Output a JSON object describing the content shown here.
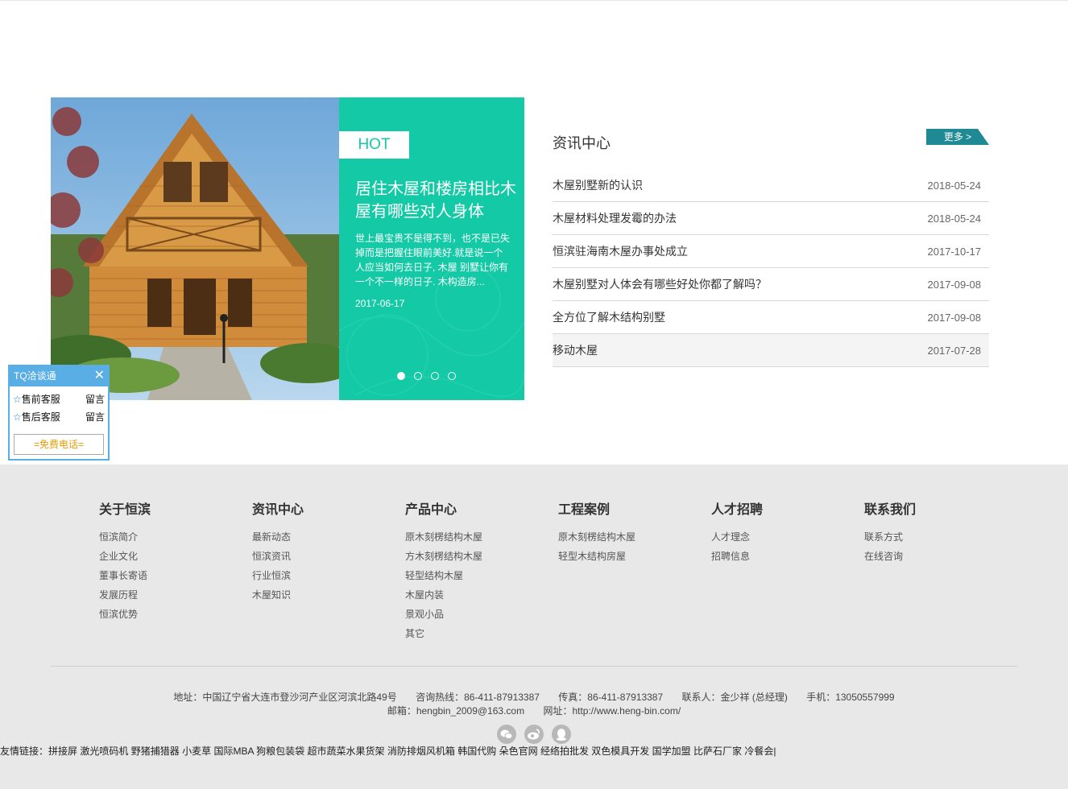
{
  "slider": {
    "tag": "HOT",
    "title": "居住木屋和楼房相比木屋有哪些对人身体",
    "summary": "世上最宝贵不是得不到，也不是已失掉而是把握住眼前美好.就是说一个人应当如何去日子, 木屋 别墅让你有一个不一样的日子. 木构造房...",
    "date": "2017-06-17",
    "dots": 4,
    "active_dot": 1,
    "accent_color": "#14c9a5"
  },
  "news": {
    "title": "资讯中心",
    "more_label": "更多 >",
    "items": [
      {
        "title": "木屋别墅新的认识",
        "date": "2018-05-24"
      },
      {
        "title": "木屋材料处理发霉的办法",
        "date": "2018-05-24"
      },
      {
        "title": "恒滨驻海南木屋办事处成立",
        "date": "2017-10-17"
      },
      {
        "title": "木屋别墅对人体会有哪些好处你都了解吗？",
        "date": "2017-09-08"
      },
      {
        "title": "全方位了解木结构别墅",
        "date": "2017-09-08"
      },
      {
        "title": "移动木屋",
        "date": "2017-07-28"
      }
    ]
  },
  "tq": {
    "title": "TQ洽谈通",
    "close": "✕",
    "rows": [
      {
        "label": "售前客服",
        "action": "留言"
      },
      {
        "label": "售后客服",
        "action": "留言"
      }
    ],
    "call": "=免费电话="
  },
  "footer": {
    "columns": [
      {
        "title": "关于恒滨",
        "items": [
          "恒滨简介",
          "企业文化",
          "董事长寄语",
          "发展历程",
          "恒滨优势"
        ]
      },
      {
        "title": "资讯中心",
        "items": [
          "最新动态",
          "恒滨资讯",
          "行业恒滨",
          "木屋知识"
        ]
      },
      {
        "title": "产品中心",
        "items": [
          "原木刻楞结构木屋",
          "方木刻楞结构木屋",
          "轻型结构木屋",
          "木屋内装",
          "景观小品",
          "其它"
        ]
      },
      {
        "title": "工程案例",
        "items": [
          "原木刻楞结构木屋",
          "轻型木结构房屋"
        ]
      },
      {
        "title": "人才招聘",
        "items": [
          "人才理念",
          "招聘信息"
        ]
      },
      {
        "title": "联系我们",
        "items": [
          "联系方式",
          "在线咨询"
        ]
      }
    ],
    "address": "地址：中国辽宁省大连市登沙河产业区河滨北路49号",
    "hotline": "咨询热线：86-411-87913387",
    "fax": "传真：86-411-87913387",
    "contact": "联系人：金少祥 (总经理)",
    "mobile": "手机：13050557999",
    "email": "邮箱：hengbin_2009@163.com",
    "website": "网址：http://www.heng-bin.com/",
    "social_icons": [
      "wechat-icon",
      "weibo-icon",
      "qq-icon"
    ],
    "links_label": "友情链接：",
    "links": [
      "拼接屏",
      "激光喷码机",
      "野猪捕猎器",
      "小麦草",
      "国际MBA",
      "狗粮包装袋",
      "超市蔬菜水果货架",
      "消防排烟风机箱",
      "韩国代购",
      "朵色官网",
      "经络拍批发",
      "双色模具开发",
      "国学加盟",
      "比萨石厂家",
      "冷餐会|"
    ]
  }
}
